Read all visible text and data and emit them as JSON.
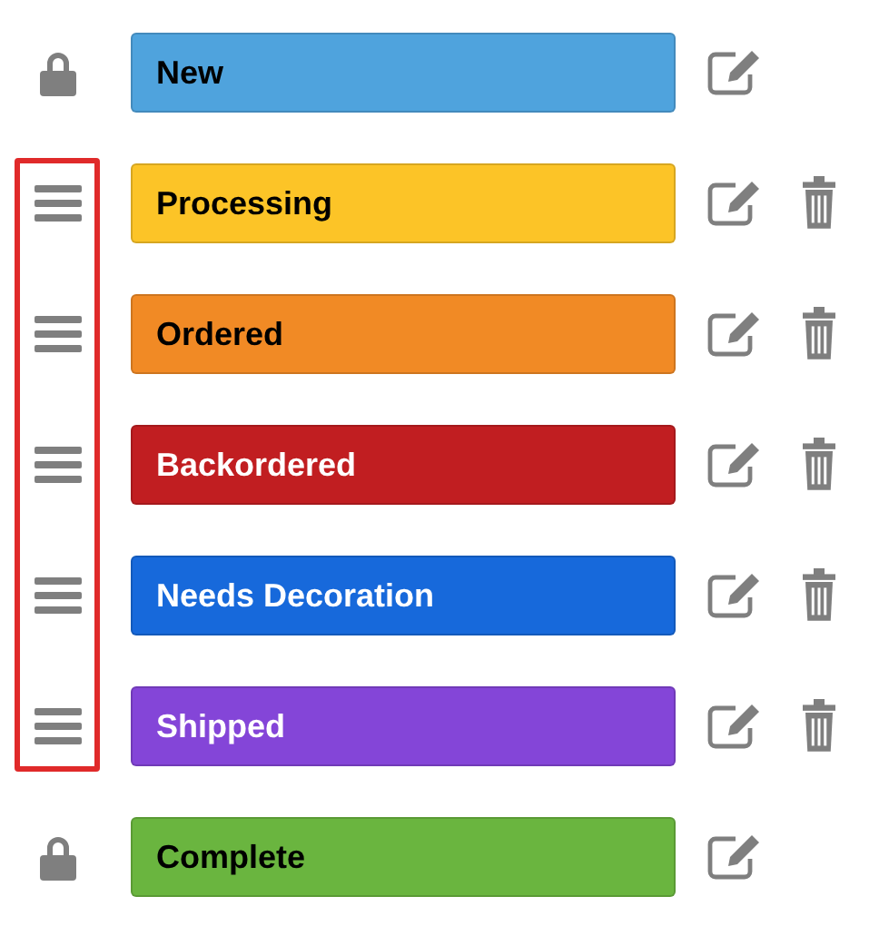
{
  "handles_highlighted": true,
  "statuses": [
    {
      "label": "New",
      "color": "#4fa3dd",
      "light_label": false,
      "kind": "locked"
    },
    {
      "label": "Processing",
      "color": "#fcc427",
      "light_label": false,
      "kind": "draggable"
    },
    {
      "label": "Ordered",
      "color": "#f18a25",
      "light_label": false,
      "kind": "draggable"
    },
    {
      "label": "Backordered",
      "color": "#c11e21",
      "light_label": true,
      "kind": "draggable"
    },
    {
      "label": "Needs Decoration",
      "color": "#1769db",
      "light_label": true,
      "kind": "draggable"
    },
    {
      "label": "Shipped",
      "color": "#8445d8",
      "light_label": true,
      "kind": "draggable"
    },
    {
      "label": "Complete",
      "color": "#6ab53f",
      "light_label": false,
      "kind": "locked"
    }
  ]
}
